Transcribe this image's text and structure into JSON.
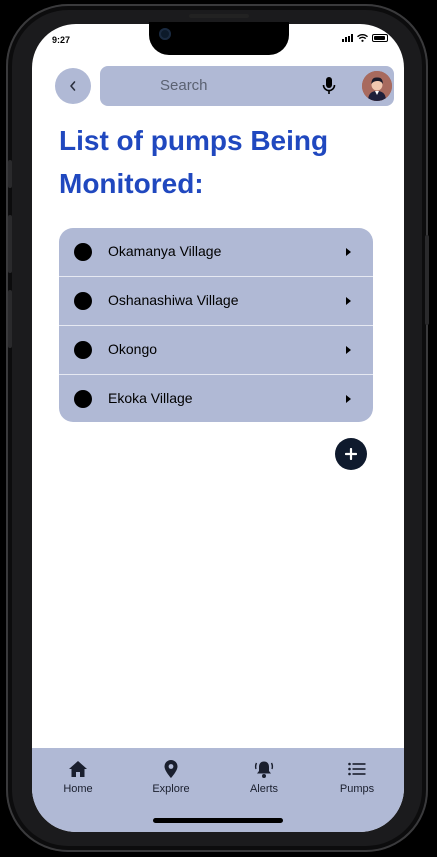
{
  "status_bar": {
    "time": "9:27"
  },
  "header": {
    "search_placeholder": "Search"
  },
  "page": {
    "title": "List of pumps Being Monitored:"
  },
  "pumps": [
    {
      "name": "Okamanya Village"
    },
    {
      "name": "Oshanashiwa Village"
    },
    {
      "name": "Okongo"
    },
    {
      "name": "Ekoka Village"
    }
  ],
  "nav": {
    "items": [
      {
        "label": "Home",
        "icon": "home-icon"
      },
      {
        "label": "Explore",
        "icon": "location-pin-icon"
      },
      {
        "label": "Alerts",
        "icon": "bell-icon"
      },
      {
        "label": "Pumps",
        "icon": "list-icon"
      }
    ]
  },
  "colors": {
    "accent": "#2048bf",
    "surface": "#b0b9d5",
    "fab": "#0f1a2d"
  }
}
